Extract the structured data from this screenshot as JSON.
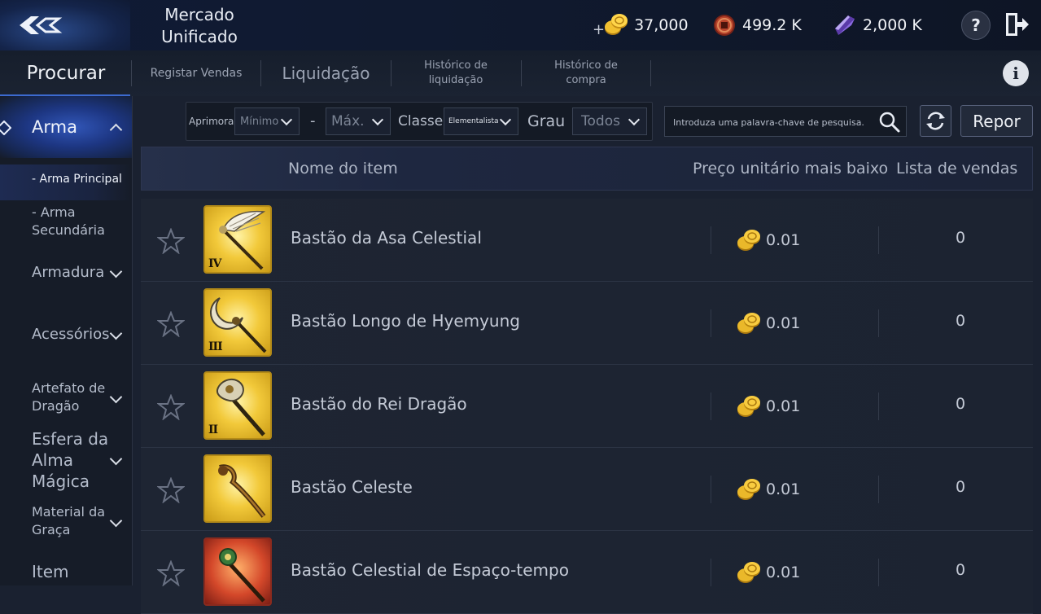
{
  "header": {
    "title_line1": "Mercado",
    "title_line2": "Unificado",
    "currency_plus": "+",
    "gold": "37,000",
    "red_coins": "499.2 K",
    "crystals": "2,000 K",
    "help_label": "?"
  },
  "tabs": [
    {
      "label": "Procurar"
    },
    {
      "label": "Registar Vendas"
    },
    {
      "label": "Liquidação"
    },
    {
      "label": "Histórico de liquidação"
    },
    {
      "label": "Histórico de compra"
    }
  ],
  "info_label": "i",
  "sidebar": {
    "items": [
      {
        "label": "Arma"
      },
      {
        "label": "- Arma Principal"
      },
      {
        "label": "- Arma Secundária"
      },
      {
        "label": "Armadura"
      },
      {
        "label": "Acessórios"
      },
      {
        "label": "Artefato de Dragão"
      },
      {
        "label": "Esfera da Alma Mágica"
      },
      {
        "label": "Material da Graça"
      },
      {
        "label": "Item"
      }
    ]
  },
  "filters": {
    "enhance_label": "Aprimorar",
    "min_value": "Mínimo",
    "dash": "-",
    "max_value": "Máx.",
    "class_label": "Classe",
    "class_value": "Elementalista",
    "grade_label": "Grau",
    "grade_value": "Todos",
    "search_placeholder": "Introduza uma palavra-chave de pesquisa.",
    "reset_label": "Repor"
  },
  "table": {
    "col_name": "Nome do item",
    "col_price": "Preço unitário mais baixo",
    "col_listings": "Lista de vendas",
    "rows": [
      {
        "name": "Bastão da Asa Celestial",
        "grade": "IV",
        "price": "0.01",
        "listings": "0"
      },
      {
        "name": "Bastão Longo de Hyemyung",
        "grade": "III",
        "price": "0.01",
        "listings": "0"
      },
      {
        "name": "Bastão do Rei Dragão",
        "grade": "II",
        "price": "0.01",
        "listings": "0"
      },
      {
        "name": "Bastão Celeste",
        "grade": "",
        "price": "0.01",
        "listings": "0"
      },
      {
        "name": "Bastão Celestial de Espaço-tempo",
        "grade": "",
        "price": "0.01",
        "listings": "0"
      }
    ]
  },
  "colors": {
    "accent": "#3c6ad0",
    "gold": "#e0b12a",
    "background": "#1a2130"
  }
}
